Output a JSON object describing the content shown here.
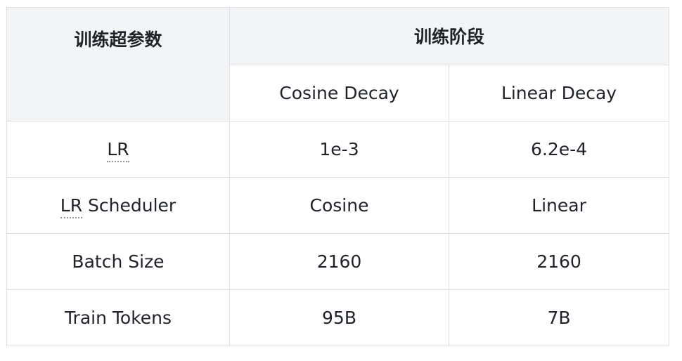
{
  "table": {
    "header": {
      "param_col": "训练超参数",
      "stage_group": "训练阶段",
      "stages": [
        "Cosine Decay",
        "Linear Decay"
      ]
    },
    "rows": [
      {
        "param_abbr": "LR",
        "param_rest": "",
        "values": [
          "1e-3",
          "6.2e-4"
        ]
      },
      {
        "param_abbr": "LR",
        "param_rest": " Scheduler",
        "values": [
          "Cosine",
          "Linear"
        ]
      },
      {
        "param_abbr": "",
        "param_rest": "Batch Size",
        "values": [
          "2160",
          "2160"
        ]
      },
      {
        "param_abbr": "",
        "param_rest": "Train Tokens",
        "values": [
          "95B",
          "7B"
        ]
      }
    ]
  }
}
